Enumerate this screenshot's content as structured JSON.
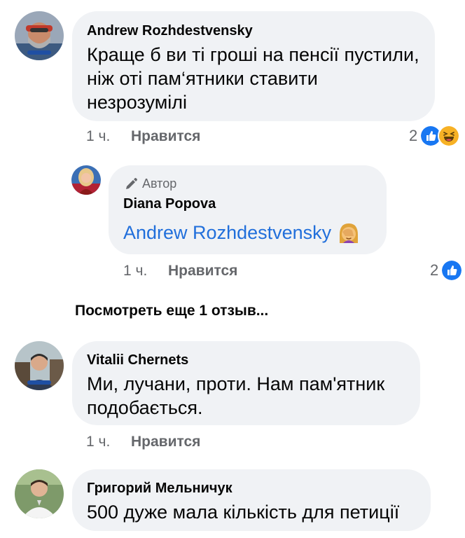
{
  "comments": [
    {
      "author": "Andrew Rozhdestvensky",
      "text_lines": [
        "Краще б ви ті гроші на пенсії пустили,",
        "ніж оті пам‘ятники ставити",
        "незрозумілі"
      ],
      "time": "1 ч.",
      "like_label": "Нравится",
      "reaction_count": "2",
      "reactions": [
        "like-icon",
        "haha-icon"
      ]
    },
    {
      "author": "Vitalii Chernets",
      "text_lines": [
        "Ми, лучани, проти. Нам пам'ятник",
        "подобається."
      ],
      "time": "1 ч.",
      "like_label": "Нравится"
    },
    {
      "author": "Григорий Мельничук",
      "text_lines": [
        "500 дуже мала кількість для петиції"
      ]
    }
  ],
  "reply": {
    "badge_label": "Автор",
    "author": "Diana Popova",
    "mention": "Andrew Rozhdestvensky",
    "emoji": "face-palm-emoji",
    "time": "1 ч.",
    "like_label": "Нравится",
    "reaction_count": "2",
    "reactions": [
      "like-icon"
    ]
  },
  "more_replies_label": "Посмотреть еще 1 отзыв...",
  "colors": {
    "bubble": "#f0f2f5",
    "meta": "#65676b",
    "mention": "#216fdb",
    "like": "#1877f2",
    "haha": "#f7b125"
  }
}
